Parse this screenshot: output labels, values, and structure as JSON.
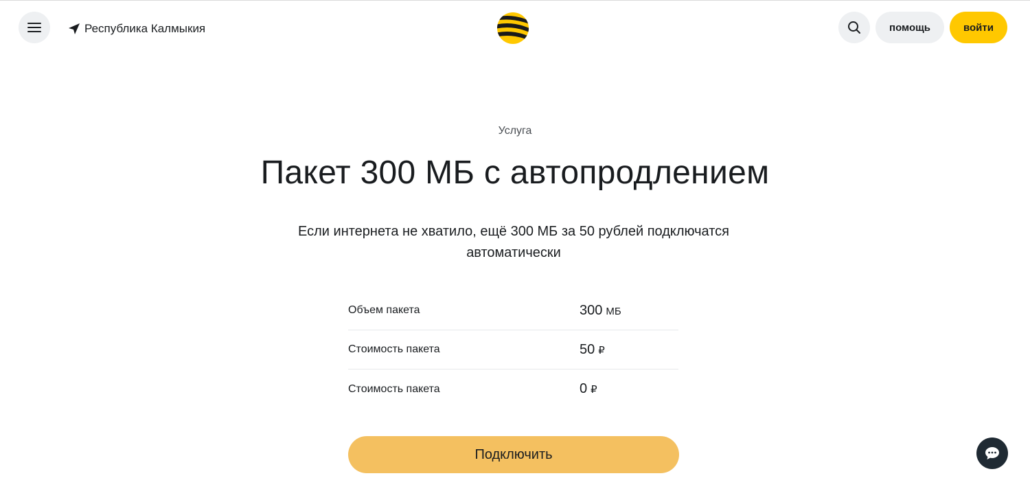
{
  "header": {
    "region": "Республика Калмыкия",
    "help_label": "помощь",
    "login_label": "войти",
    "icons": {
      "menu": "hamburger-menu-icon",
      "location": "location-arrow-icon",
      "logo": "beeline-logo",
      "search": "search-icon"
    }
  },
  "main": {
    "eyebrow": "Услуга",
    "title": "Пакет 300 МБ с автопродлением",
    "description": "Если интернета не хватило, ещё 300 МБ за 50 рублей подключатся автоматически",
    "params": [
      {
        "label": "Объем пакета",
        "value": "300",
        "unit": "МБ"
      },
      {
        "label": "Стоимость пакета",
        "value": "50",
        "unit": "₽"
      },
      {
        "label": "Стоимость пакета",
        "value": "0",
        "unit": "₽"
      }
    ],
    "connect_label": "Подключить"
  },
  "chat": {
    "icon": "chat-bubble-icon"
  },
  "colors": {
    "accent": "#ffc800",
    "button_secondary": "#eef0f2",
    "connect_button": "#f4c060",
    "chat_button": "#1f2a33",
    "text": "#191c1f"
  }
}
